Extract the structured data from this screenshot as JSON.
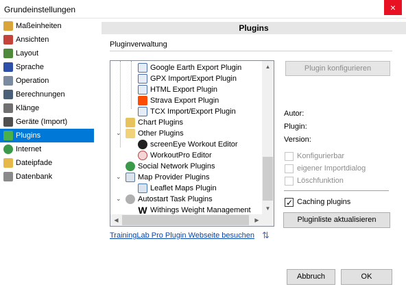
{
  "window": {
    "title": "Grundeinstellungen",
    "close_symbol": "×"
  },
  "sidebar": {
    "items": [
      {
        "label": "Maßeinheiten",
        "icon": "ruler-icon",
        "color": "#d9a43a"
      },
      {
        "label": "Ansichten",
        "icon": "calendar-icon",
        "color": "#c4443a"
      },
      {
        "label": "Layout",
        "icon": "layout-icon",
        "color": "#4f8a3a"
      },
      {
        "label": "Sprache",
        "icon": "eu-flag-icon",
        "color": "#2d4fa8"
      },
      {
        "label": "Operation",
        "icon": "wrench-icon",
        "color": "#7a8aa0"
      },
      {
        "label": "Berechnungen",
        "icon": "calculator-icon",
        "color": "#4a6078"
      },
      {
        "label": "Klänge",
        "icon": "speaker-icon",
        "color": "#707070"
      },
      {
        "label": "Geräte (Import)",
        "icon": "device-icon",
        "color": "#505050"
      },
      {
        "label": "Plugins",
        "icon": "puzzle-icon",
        "color": "#4ab04a"
      },
      {
        "label": "Internet",
        "icon": "globe-icon",
        "color": "#3a9a4a"
      },
      {
        "label": "Dateipfade",
        "icon": "folder-icon",
        "color": "#e6b84a"
      },
      {
        "label": "Datenbank",
        "icon": "database-icon",
        "color": "#8a8a8a"
      }
    ],
    "selected": "Plugins",
    "selected_color": "#0078d7"
  },
  "main": {
    "header": "Plugins",
    "section_label": "Pluginverwaltung",
    "tree": [
      {
        "label": "Google Earth Export Plugin",
        "icon": "document-icon",
        "color": "#4a6ea8",
        "level": 2
      },
      {
        "label": "GPX Import/Export Plugin",
        "icon": "document-icon",
        "color": "#4a6ea8",
        "level": 2
      },
      {
        "label": "HTML Export Plugin",
        "icon": "document-icon",
        "color": "#4a6ea8",
        "level": 2
      },
      {
        "label": "Strava Export Plugin",
        "icon": "strava-icon",
        "color": "#fc4c02",
        "level": 2
      },
      {
        "label": "TCX Import/Export Plugin",
        "icon": "document-icon",
        "color": "#4a6ea8",
        "level": 2
      },
      {
        "label": "Chart Plugins",
        "icon": "folder-icon",
        "color": "#e6c35c",
        "level": 1
      },
      {
        "label": "Other Plugins",
        "icon": "folder-open-icon",
        "color": "#e6c35c",
        "level": 1,
        "expanded": true
      },
      {
        "label": "screenEye Workout Editor",
        "icon": "eye-icon",
        "color": "#202020",
        "level": 2
      },
      {
        "label": "WorkoutPro Editor",
        "icon": "stopwatch-icon",
        "color": "#c04040",
        "level": 2
      },
      {
        "label": "Social Network Plugins",
        "icon": "globe-icon",
        "color": "#3a9a4a",
        "level": 1
      },
      {
        "label": "Map Provider Plugins",
        "icon": "map-icon",
        "color": "#607890",
        "level": 1,
        "expanded": true
      },
      {
        "label": "Leaflet Maps Plugin",
        "icon": "map-icon",
        "color": "#4a7ab0",
        "level": 2
      },
      {
        "label": "Autostart Task Plugins",
        "icon": "gears-icon",
        "color": "#808080",
        "level": 1,
        "expanded": true
      },
      {
        "label": "Withings Weight Management",
        "icon": "withings-w-icon",
        "color": "#000000",
        "level": 2
      }
    ],
    "config_button": "Plugin konfigurieren",
    "info": {
      "author_label": "Autor:",
      "plugin_label": "Plugin:",
      "version_label": "Version:"
    },
    "checkboxes": [
      {
        "label": "Konfigurierbar",
        "checked": false,
        "enabled": false
      },
      {
        "label": "eigener Importdialog",
        "checked": false,
        "enabled": false
      },
      {
        "label": "Löschfunktion",
        "checked": false,
        "enabled": false
      }
    ],
    "caching": {
      "label": "Caching plugins",
      "checked": true
    },
    "refresh_button": "Pluginliste aktualisieren",
    "website_link": "TrainingLab Pro Plugin Webseite besuchen"
  },
  "footer": {
    "cancel": "Abbruch",
    "ok": "OK"
  }
}
